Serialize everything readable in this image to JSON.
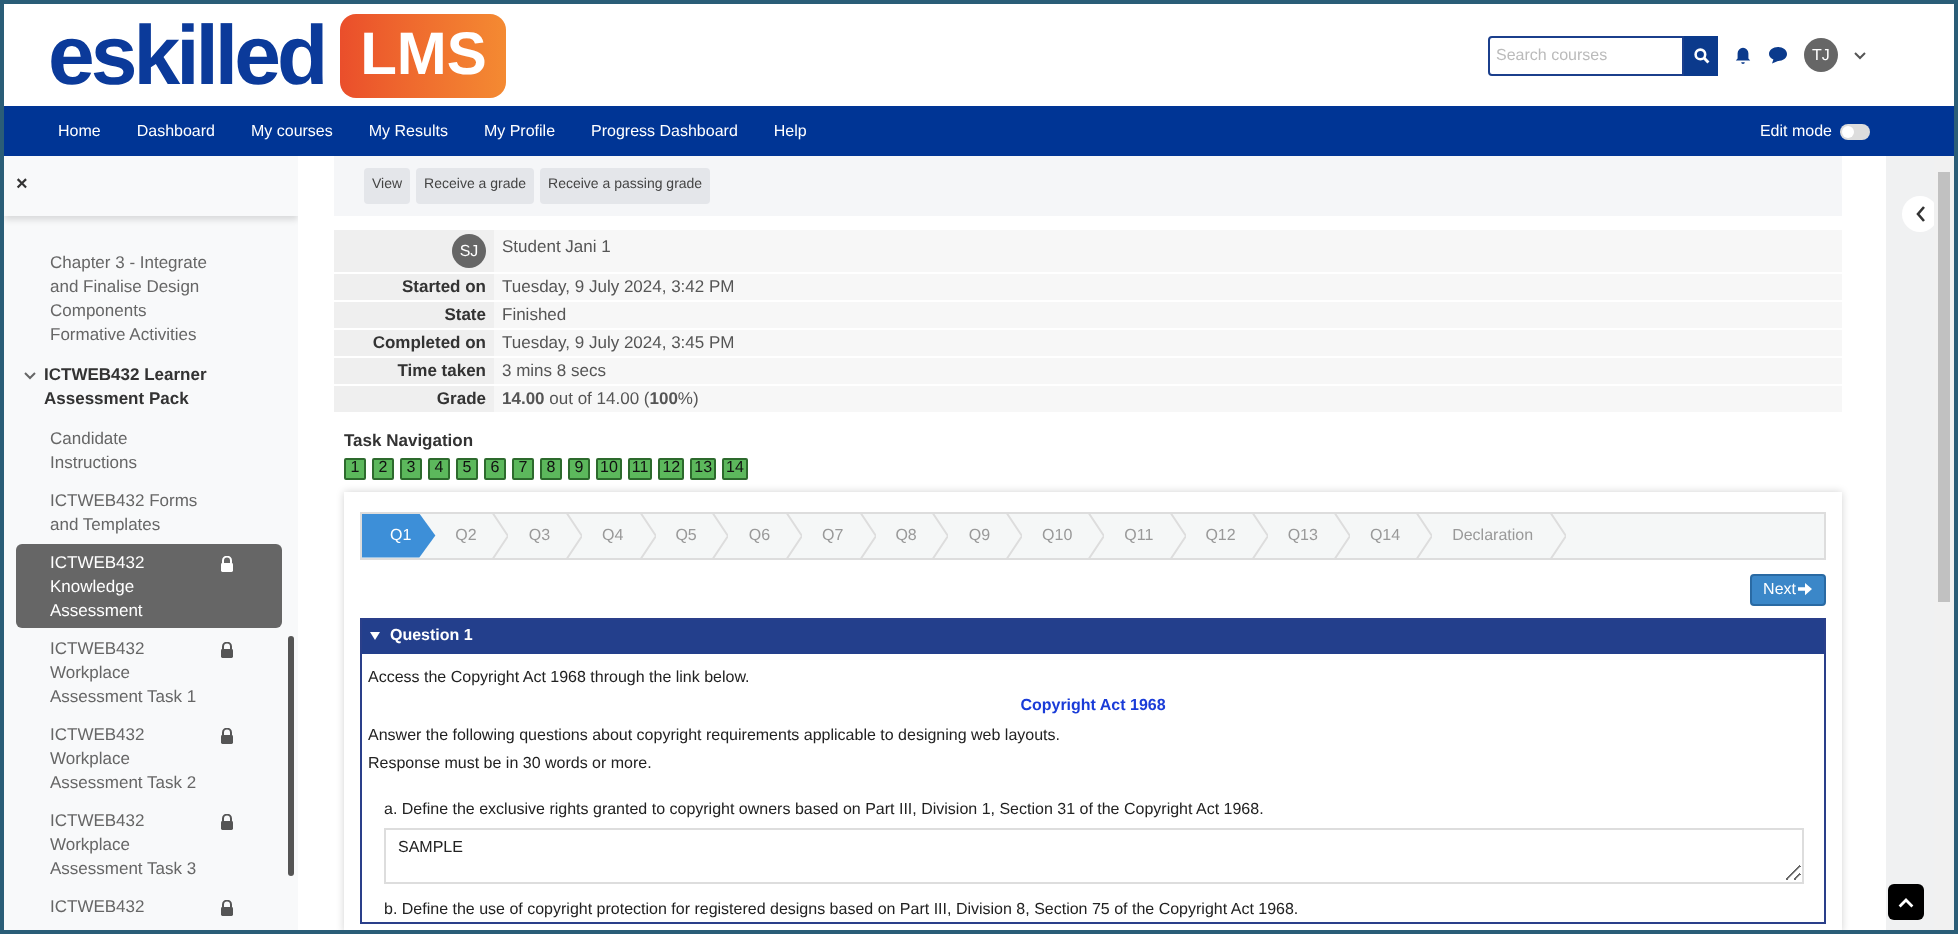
{
  "header": {
    "logo_main": "eskilled",
    "logo_badge": "LMS",
    "search": {
      "placeholder": "Search courses"
    },
    "user_initials": "TJ"
  },
  "nav": {
    "items": [
      "Home",
      "Dashboard",
      "My courses",
      "My Results",
      "My Profile",
      "Progress Dashboard",
      "Help"
    ],
    "edit_mode": {
      "label": "Edit mode",
      "on": false
    }
  },
  "sidebar": {
    "close": "×",
    "items": [
      {
        "kind": "link",
        "label": "Chapter 3 - Integrate and Finalise Design Components Formative Activities",
        "selected": false,
        "locked": false
      },
      {
        "kind": "section",
        "label": "ICTWEB432 Learner Assessment Pack",
        "expanded": true
      },
      {
        "kind": "link",
        "label": "Candidate Instructions",
        "selected": false,
        "locked": false
      },
      {
        "kind": "link",
        "label": "ICTWEB432 Forms and Templates",
        "selected": false,
        "locked": false
      },
      {
        "kind": "link",
        "label": "ICTWEB432 Knowledge Assessment",
        "selected": true,
        "locked": true
      },
      {
        "kind": "link",
        "label": "ICTWEB432 Workplace Assessment Task 1",
        "selected": false,
        "locked": true
      },
      {
        "kind": "link",
        "label": "ICTWEB432 Workplace Assessment Task 2",
        "selected": false,
        "locked": true
      },
      {
        "kind": "link",
        "label": "ICTWEB432 Workplace Assessment Task 3",
        "selected": false,
        "locked": true
      },
      {
        "kind": "link",
        "label": "ICTWEB432",
        "selected": false,
        "locked": true
      }
    ]
  },
  "actions": [
    "View",
    "Receive a grade",
    "Receive a passing grade"
  ],
  "summary": {
    "avatar": "SJ",
    "student": "Student Jani 1",
    "rows": [
      {
        "label": "Started on",
        "value": "Tuesday, 9 July 2024, 3:42 PM"
      },
      {
        "label": "State",
        "value": "Finished"
      },
      {
        "label": "Completed on",
        "value": "Tuesday, 9 July 2024, 3:45 PM"
      },
      {
        "label": "Time taken",
        "value": "3 mins 8 secs"
      },
      {
        "label": "Grade",
        "value": "**14.00** out of 14.00 (**100**%)"
      }
    ]
  },
  "task_navigation": {
    "title": "Task Navigation",
    "items": [
      {
        "label": "1",
        "correct": true
      },
      {
        "label": "2",
        "correct": true
      },
      {
        "label": "3",
        "correct": true
      },
      {
        "label": "4",
        "correct": true
      },
      {
        "label": "5",
        "correct": true
      },
      {
        "label": "6",
        "correct": true
      },
      {
        "label": "7",
        "correct": true
      },
      {
        "label": "8",
        "correct": true
      },
      {
        "label": "9",
        "correct": true
      },
      {
        "label": "10",
        "correct": true
      },
      {
        "label": "11",
        "correct": true
      },
      {
        "label": "12",
        "correct": true
      },
      {
        "label": "13",
        "correct": true
      },
      {
        "label": "14",
        "correct": true
      }
    ]
  },
  "steps": [
    {
      "label": "Q1",
      "selected": true
    },
    {
      "label": "Q2",
      "selected": false
    },
    {
      "label": "Q3",
      "selected": false
    },
    {
      "label": "Q4",
      "selected": false
    },
    {
      "label": "Q5",
      "selected": false
    },
    {
      "label": "Q6",
      "selected": false
    },
    {
      "label": "Q7",
      "selected": false
    },
    {
      "label": "Q8",
      "selected": false
    },
    {
      "label": "Q9",
      "selected": false
    },
    {
      "label": "Q10",
      "selected": false
    },
    {
      "label": "Q11",
      "selected": false
    },
    {
      "label": "Q12",
      "selected": false
    },
    {
      "label": "Q13",
      "selected": false
    },
    {
      "label": "Q14",
      "selected": false
    },
    {
      "label": "Declaration",
      "selected": false
    }
  ],
  "next_button": "Next",
  "question": {
    "title": "Question 1",
    "intro": "Access the Copyright Act 1968 through the link below.",
    "link": "Copyright Act 1968",
    "lines": [
      "Answer the following questions about copyright requirements applicable to designing web layouts.",
      "Response must be in 30 words or more."
    ],
    "parts": [
      {
        "prompt": "a. Define the exclusive rights granted to copyright owners based on Part III, Division 1, Section 31 of the Copyright Act 1968.",
        "answer": "SAMPLE"
      },
      {
        "prompt": "b. Define the use of copyright protection for registered designs based on Part III, Division 8, Section 75 of the Copyright Act 1968."
      }
    ]
  }
}
